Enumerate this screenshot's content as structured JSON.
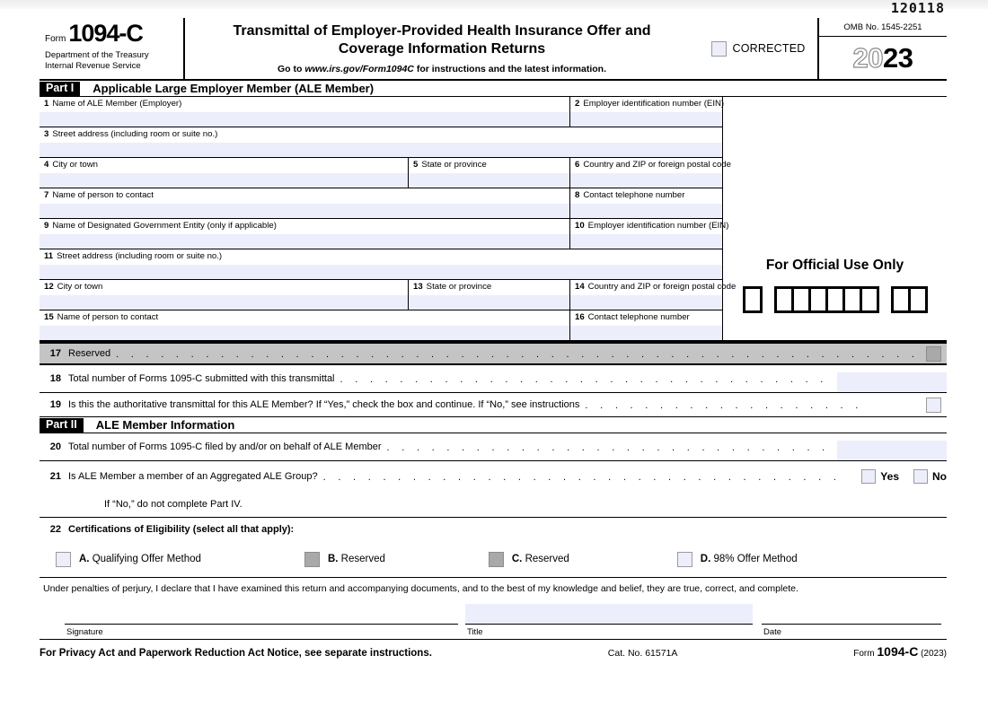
{
  "document": {
    "barcode": "120118",
    "form_word": "Form",
    "form_number": "1094-C",
    "department_line1": "Department of the Treasury",
    "department_line2": "Internal Revenue Service",
    "title_line1": "Transmittal of Employer-Provided Health Insurance Offer and",
    "title_line2": "Coverage Information Returns",
    "goto_prefix": "Go to",
    "goto_url": "www.irs.gov/Form1094C",
    "goto_suffix": "for instructions and the latest information.",
    "corrected_label": "CORRECTED",
    "omb_label": "OMB No. 1545-2251",
    "year_prefix": "20",
    "year_suffix": "23"
  },
  "part1": {
    "tag": "Part I",
    "title": "Applicable Large Employer Member (ALE Member)",
    "official_use_title": "For Official Use Only",
    "official_use_boxes": {
      "single": 1,
      "group_a": 6,
      "group_b": 2
    },
    "fields": [
      {
        "num": "1",
        "label": "Name of ALE Member (Employer)"
      },
      {
        "num": "2",
        "label": "Employer identification number (EIN)"
      },
      {
        "num": "3",
        "label": "Street address (including room or suite no.)"
      },
      {
        "num": "4",
        "label": "City or town"
      },
      {
        "num": "5",
        "label": "State or province"
      },
      {
        "num": "6",
        "label": "Country and ZIP or foreign postal code"
      },
      {
        "num": "7",
        "label": "Name of person to contact"
      },
      {
        "num": "8",
        "label": "Contact telephone number"
      },
      {
        "num": "9",
        "label": "Name of Designated Government Entity (only if applicable)"
      },
      {
        "num": "10",
        "label": "Employer identification number (EIN)"
      },
      {
        "num": "11",
        "label": "Street address (including room or suite no.)"
      },
      {
        "num": "12",
        "label": "City or town"
      },
      {
        "num": "13",
        "label": "State or province"
      },
      {
        "num": "14",
        "label": "Country and ZIP or foreign postal code"
      },
      {
        "num": "15",
        "label": "Name of person to contact"
      },
      {
        "num": "16",
        "label": "Contact telephone number"
      }
    ]
  },
  "lines": {
    "l17_num": "17",
    "l17_text": "Reserved",
    "l18_num": "18",
    "l18_text": "Total number of Forms 1095-C submitted with this transmittal",
    "l18_value": "",
    "l19_num": "19",
    "l19_text": "Is this the authoritative transmittal for this ALE Member? If “Yes,” check the box and continue. If “No,” see instructions",
    "l20_num": "20",
    "l20_text": "Total number of Forms 1095-C filed by and/or on behalf of ALE Member",
    "l20_value": "",
    "l21_num": "21",
    "l21_text": "Is ALE Member a member of an Aggregated ALE Group?",
    "l21_yes": "Yes",
    "l21_no": "No",
    "l21_note": "If “No,” do not complete Part IV.",
    "l22_num": "22",
    "l22_text": "Certifications of Eligibility (select all that apply):"
  },
  "part2": {
    "tag": "Part II",
    "title": "ALE Member Information"
  },
  "certifications": [
    {
      "letter": "A.",
      "label": "Qualifying Offer Method",
      "disabled": false
    },
    {
      "letter": "B.",
      "label": "Reserved",
      "disabled": true
    },
    {
      "letter": "C.",
      "label": "Reserved",
      "disabled": true
    },
    {
      "letter": "D.",
      "label": "98% Offer Method",
      "disabled": false
    }
  ],
  "signature": {
    "perjury": "Under penalties of perjury, I declare that I have examined this return and accompanying documents, and to the best of my knowledge and belief, they are true, correct, and complete.",
    "signature_label": "Signature",
    "title_label": "Title",
    "title_value": "",
    "date_label": "Date"
  },
  "footer": {
    "privacy_notice": "For Privacy Act and Paperwork Reduction Act Notice, see separate instructions.",
    "cat_no": "Cat. No. 61571A",
    "form_word": "Form",
    "form_number": "1094-C",
    "form_year": "(2023)"
  },
  "colors": {
    "input_fill": "#eceefb",
    "disabled_gray": "#a9a9a9",
    "reserved_row": "#c4c4c4",
    "rule": "#000000"
  }
}
